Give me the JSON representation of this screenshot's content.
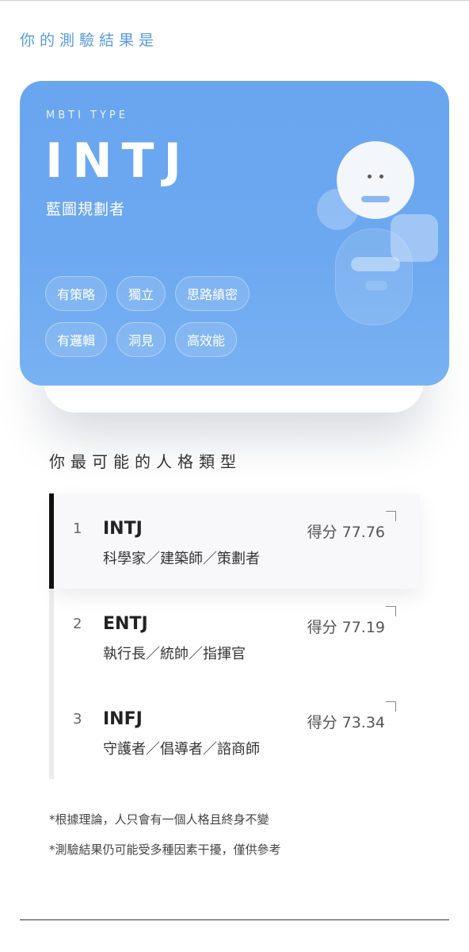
{
  "header": {
    "title": "你的測驗結果是"
  },
  "card": {
    "eyebrow": "MBTI TYPE",
    "type": "INTJ",
    "name": "藍圖規劃者",
    "traits": [
      [
        "有策略",
        "獨立",
        "思路縝密"
      ],
      [
        "有邏輯",
        "洞見",
        "高效能"
      ]
    ]
  },
  "ranking": {
    "title": "你最可能的人格類型",
    "items": [
      {
        "rank": "1",
        "type": "INTJ",
        "score": "得分 77.76",
        "roles": "科學家／建築師／策劃者",
        "active": true
      },
      {
        "rank": "2",
        "type": "ENTJ",
        "score": "得分 77.19",
        "roles": "執行長／統帥／指揮官",
        "active": false
      },
      {
        "rank": "3",
        "type": "INFJ",
        "score": "得分 73.34",
        "roles": "守護者／倡導者／諮商師",
        "active": false
      }
    ]
  },
  "notes": [
    "*根據理論，人只會有一個人格且終身不變",
    "*測驗結果仍可能受多種因素干擾，僅供參考"
  ],
  "colors": {
    "accent": "#5a9ad8",
    "card": "#6aa6ef"
  }
}
